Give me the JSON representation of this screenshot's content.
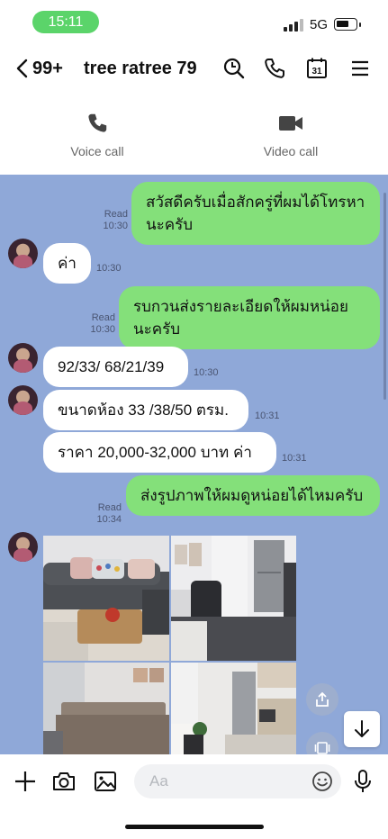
{
  "status": {
    "time": "15:11",
    "network": "5G"
  },
  "header": {
    "back_count": "99+",
    "title": "tree ratree 79",
    "calendar_day": "31"
  },
  "callbar": {
    "voice_label": "Voice call",
    "video_label": "Video call"
  },
  "messages": [
    {
      "dir": "out",
      "text": "สวัสดีครับเมื่อสักครู่ที่ผมได้โทรหานะครับ",
      "read": "Read",
      "time": "10:30"
    },
    {
      "dir": "in",
      "text": "ค่า",
      "time": "10:30"
    },
    {
      "dir": "out",
      "text": "รบกวนส่งรายละเอียดให้ผมหน่อยนะครับ",
      "read": "Read",
      "time": "10:30"
    },
    {
      "dir": "in",
      "text": "92/33/ 68/21/39",
      "time": "10:30"
    },
    {
      "dir": "in",
      "text": "ขนาดห้อง 33 /38/50 ตรม.",
      "time": "10:31"
    },
    {
      "dir": "in",
      "text": "ราคา 20,000-32,000 บาท ค่า",
      "time": "10:31"
    },
    {
      "dir": "out",
      "text": "ส่งรูปภาพให้ผมดูหน่อยได้ไหมครับ",
      "read": "Read",
      "time": "10:34"
    }
  ],
  "photos": [
    "living-room",
    "workspace-kitchen",
    "bedroom",
    "kitchenette"
  ],
  "input": {
    "placeholder": "Aa"
  },
  "colors": {
    "outgoing": "#84e07a",
    "chat_bg": "#8fa8d8",
    "status_pill": "#5bd46a"
  }
}
